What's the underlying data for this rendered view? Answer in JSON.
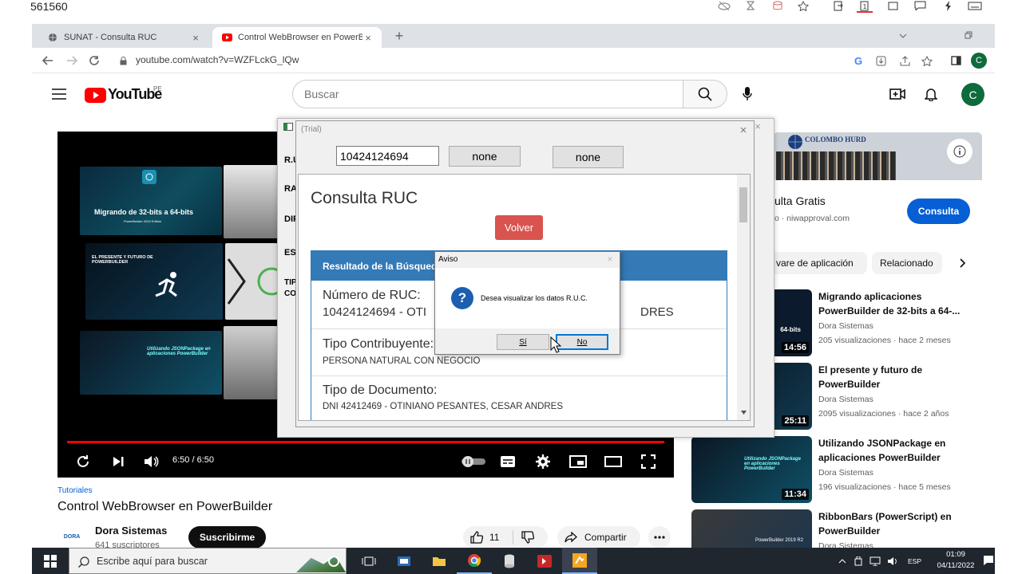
{
  "screen_caption": "561560",
  "browser": {
    "tabs": [
      {
        "label": "SUNAT - Consulta RUC",
        "active": false
      },
      {
        "label": "Control WebBrowser en PowerB",
        "active": true
      }
    ],
    "url": "youtube.com/watch?v=WZFLckG_lQw",
    "profile_initial": "C"
  },
  "youtube": {
    "logo_text": "YouTube",
    "region": "PE",
    "search_placeholder": "Buscar",
    "avatar_initial": "C",
    "player": {
      "time": "6:50 / 6:50",
      "progress_fraction": 1.0,
      "thumbs": [
        {
          "title": "Migrando de 32-bits a 64-bits",
          "sub": "PowerBuilder 2022 Edition"
        },
        {
          "title": "EL PRESENTE Y FUTURO DE POWERBUILDER"
        },
        {
          "title": "Utilizando JSONPackage en aplicaciones PowerBuilder"
        }
      ],
      "left_partial_labels": [
        "R.U",
        "RA",
        "DIF",
        "ES",
        "TIP",
        "CO"
      ]
    },
    "video": {
      "category": "Tutoriales",
      "title": "Control WebBrowser en PowerBuilder",
      "channel": "Dora Sistemas",
      "channel_logo": "DORA",
      "subscribers": "641 suscriptores",
      "subscribe_label": "Suscribirme",
      "likes": "11",
      "share_label": "Compartir"
    },
    "ad": {
      "brand": "COLOMBO HURD",
      "title_partial": "ulta Gratis",
      "domain_partial": "o · niwapproval.com",
      "cta": "Consulta"
    },
    "chips": [
      "vare de aplicación",
      "Relacionado"
    ],
    "recommendations": [
      {
        "title": "Migrando aplicaciones PowerBuilder de 32-bits a 64-...",
        "channel": "Dora Sistemas",
        "views": "205 visualizaciones",
        "age": "hace 2 meses",
        "duration": "14:56",
        "thumb_label": "64-bits"
      },
      {
        "title": "El presente y futuro de PowerBuilder",
        "channel": "Dora Sistemas",
        "views": "2095 visualizaciones",
        "age": "hace 2 años",
        "duration": "25:11"
      },
      {
        "title": "Utilizando JSONPackage en aplicaciones PowerBuilder",
        "channel": "Dora Sistemas",
        "views": "196 visualizaciones",
        "age": "hace 5 meses",
        "duration": "11:34",
        "thumb_label": "Utilizando JSONPackage en aplicaciones PowerBuilder"
      },
      {
        "title": "RibbonBars (PowerScript) en PowerBuilder",
        "channel": "Dora Sistemas",
        "thumb_label": "PowerBuilder 2019 R2"
      }
    ]
  },
  "powerbuilder": {
    "window_title": "(Trial)",
    "ruc_value": "10424124694",
    "button1": "none",
    "button2": "none",
    "page": {
      "heading": "Consulta RUC",
      "back_button": "Volver",
      "panel_title": "Resultado de la Búsqued",
      "ruc_label": "Número de RUC:",
      "ruc_line_start": "10424124694 - OTI",
      "ruc_line_end": "DRES",
      "tipo_contrib_label": "Tipo Contribuyente:",
      "tipo_contrib_value": "PERSONA NATURAL CON NEGOCIO",
      "tipo_doc_label": "Tipo de Documento:",
      "tipo_doc_value": "DNI 42412469 - OTINIANO PESANTES, CESAR ANDRES"
    }
  },
  "dialog": {
    "title": "Aviso",
    "message": "Desea visualizar los datos R.U.C.",
    "yes": "Sí",
    "no": "No"
  },
  "taskbar": {
    "search_placeholder": "Escribe aquí para buscar",
    "language": "ESP",
    "time": "01:09",
    "date": "04/11/2022"
  },
  "colors": {
    "youtube_red": "#ff0000",
    "bootstrap_danger": "#d9534f",
    "bootstrap_primary": "#337ab7",
    "yt_blue": "#065fd4",
    "taskbar": "#20262e"
  }
}
